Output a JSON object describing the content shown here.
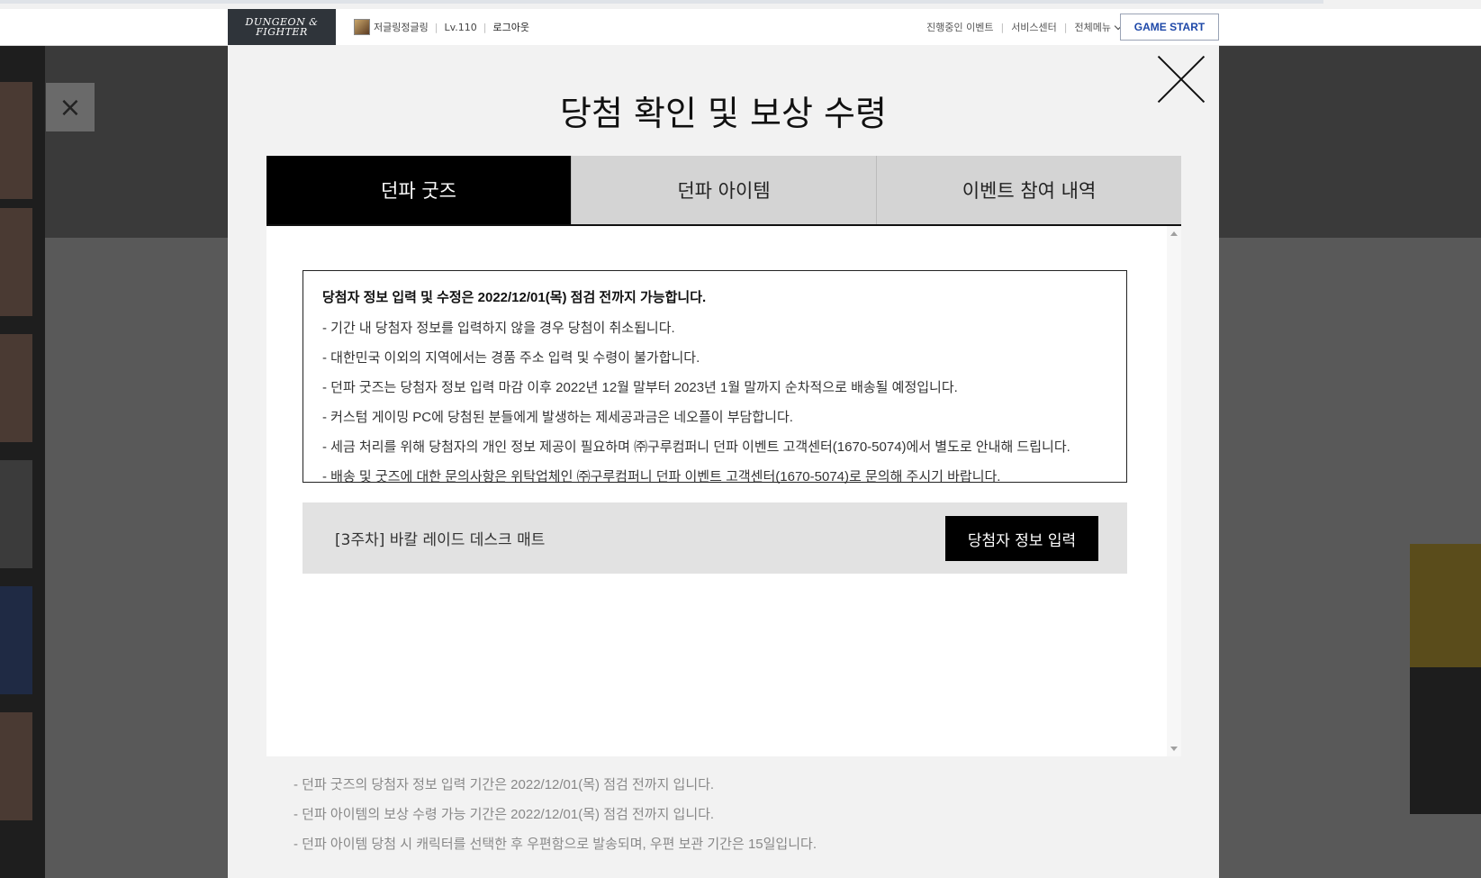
{
  "topnav": {
    "logo_text": "DUNGEON & FIGHTER",
    "user_name": "저글링정글링",
    "user_level": "Lv.110",
    "logout": "로그아웃",
    "links": [
      "진행중인 이벤트",
      "서비스센터",
      "전체메뉴"
    ],
    "game_start": "GAME START"
  },
  "background": {
    "close_glyph": "×"
  },
  "modal": {
    "title": "당첨 확인 및 보상 수령",
    "tabs": [
      {
        "label": "던파 굿즈",
        "active": true
      },
      {
        "label": "던파 아이템",
        "active": false
      },
      {
        "label": "이벤트 참여 내역",
        "active": false
      }
    ],
    "notice": {
      "heading": "당첨자 정보 입력 및 수정은 2022/12/01(목) 점검 전까지 가능합니다.",
      "lines": [
        "- 기간 내 당첨자 정보를 입력하지 않을 경우 당첨이 취소됩니다.",
        "- 대한민국 이외의 지역에서는 경품 주소 입력 및 수령이 불가합니다.",
        "- 던파 굿즈는 당첨자 정보 입력 마감 이후 2022년 12월 말부터 2023년 1월 말까지 순차적으로 배송될 예정입니다.",
        "- 커스텀 게이밍 PC에 당첨된 분들에게 발생하는 제세공과금은 네오플이 부담합니다.",
        "- 세금 처리를 위해 당첨자의 개인 정보 제공이 필요하며 ㈜구루컴퍼니 던파 이벤트 고객센터(1670-5074)에서 별도로 안내해 드립니다.",
        "- 배송 및 굿즈에 대한 문의사항은 위탁업체인 ㈜구루컴퍼니 던파 이벤트 고객센터(1670-5074)로 문의해 주시기 바랍니다."
      ]
    },
    "prize": {
      "name": "[3주차] 바칼 레이드 데스크 매트",
      "button": "당첨자 정보 입력"
    },
    "footnotes": [
      "- 던파 굿즈의 당첨자 정보 입력 기간은 2022/12/01(목) 점검 전까지 입니다.",
      "- 던파 아이템의 보상 수령 가능 기간은 2022/12/01(목) 점검 전까지 입니다.",
      "- 던파 아이템 당첨 시 캐릭터를 선택한 후 우편함으로 발송되며, 우편 보관 기간은 15일입니다."
    ]
  }
}
